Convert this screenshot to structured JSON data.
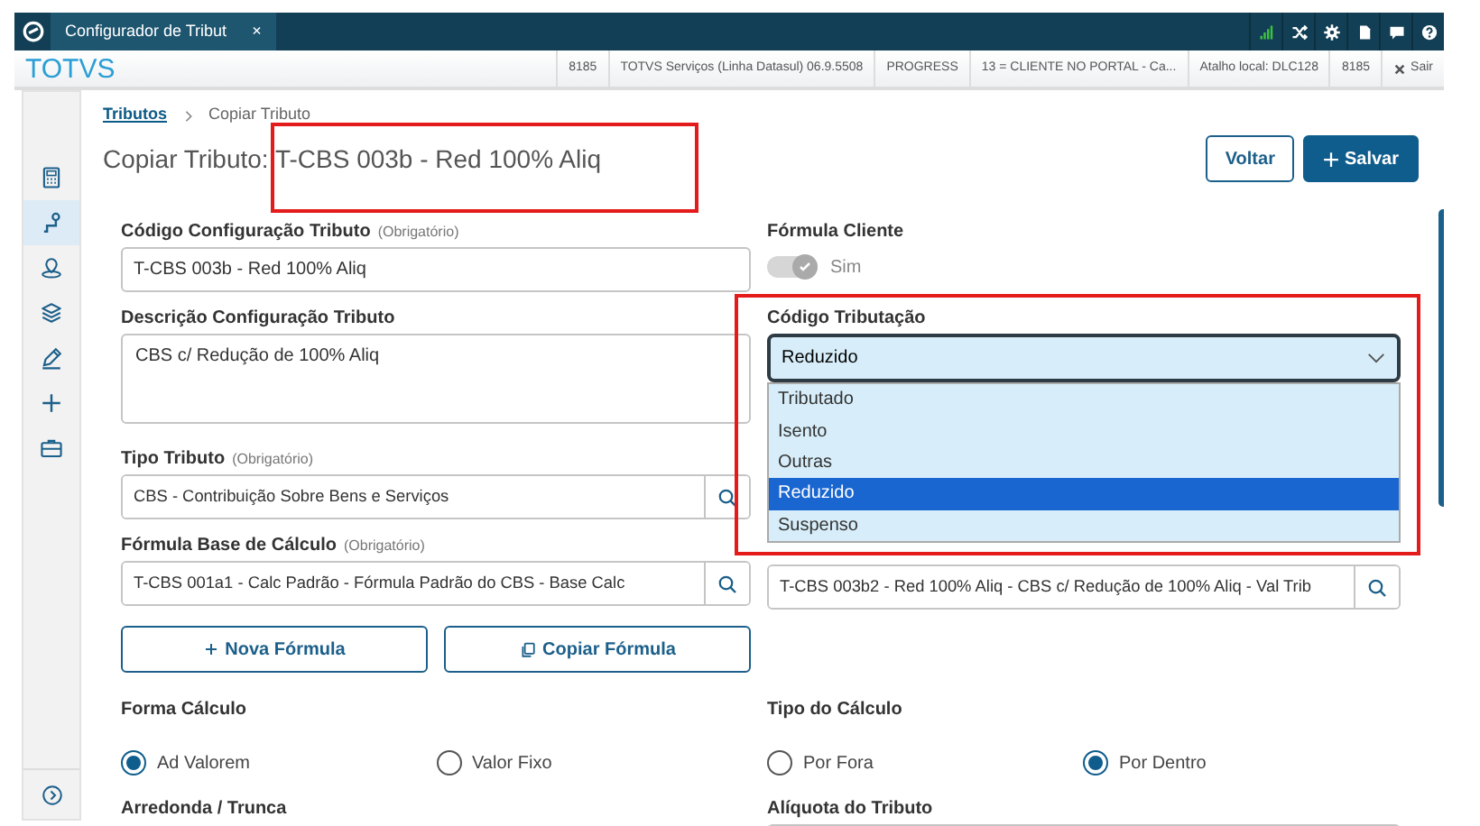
{
  "top_bar": {
    "tabs": [
      {
        "label": "Configurador de Tribut",
        "close": "×",
        "selected": true
      }
    ]
  },
  "header": {
    "brand": "TOTVS",
    "info": [
      "8185",
      "TOTVS Serviços (Linha Datasul) 06.9.5508",
      "PROGRESS",
      "13 = CLIENTE NO PORTAL - Ca...",
      "Atalho local: DLC128",
      "8185"
    ],
    "logout": "Sair"
  },
  "sidebar": {
    "items": [
      {
        "selected": false
      },
      {
        "selected": true
      },
      {
        "selected": false
      },
      {
        "selected": false
      },
      {
        "selected": false
      },
      {
        "selected": false
      },
      {
        "selected": false
      }
    ]
  },
  "breadcrumb": [
    {
      "label": "Tributos",
      "link": true
    },
    {
      "label": "Copiar Tributo",
      "link": false
    }
  ],
  "title": "Copiar Tributo: T-CBS 003b - Red 100% Aliq",
  "actions": [
    {
      "label": "Voltar",
      "kind": "outline"
    },
    {
      "label": "Salvar",
      "kind": "primary"
    }
  ],
  "rows": [
    [
      {
        "kind": "text",
        "label": "Código Configuração Tributo",
        "note": "(Obrigatório)",
        "value": "T-CBS 003b - Red 100% Aliq"
      },
      {
        "kind": "toggle",
        "label": "Fórmula Cliente",
        "on": true,
        "disabled": true,
        "text": "Sim"
      }
    ],
    [
      {
        "kind": "textarea",
        "label": "Descrição Configuração Tributo",
        "value": "CBS c/ Redução de 100% Aliq"
      },
      {
        "kind": "select",
        "label": "Código Tributação",
        "value": "Reduzido",
        "expanded": true,
        "options": [
          {
            "label": "Tributado",
            "selected": false
          },
          {
            "label": "Isento",
            "selected": false
          },
          {
            "label": "Outras",
            "selected": false
          },
          {
            "label": "Reduzido",
            "selected": true
          },
          {
            "label": "Suspenso",
            "selected": false
          }
        ]
      }
    ],
    [
      {
        "kind": "lookup",
        "label": "Tipo Tributo",
        "note": "(Obrigatório)",
        "value": "CBS - Contribuição Sobre Bens e Serviços"
      }
    ],
    [
      {
        "kind": "lookup",
        "label": "Fórmula Base de Cálculo",
        "note": "(Obrigatório)",
        "value": "T-CBS 001a1 - Calc Padrão - Fórmula Padrão do CBS - Base Calc"
      },
      {
        "kind": "lookup",
        "value": "T-CBS 003b2 - Red 100% Aliq - CBS c/ Redução de 100% Aliq - Val Trib"
      }
    ],
    [
      {
        "kind": "buttons",
        "items": [
          {
            "label": "Nova Fórmula"
          },
          {
            "label": "Copiar Fórmula"
          }
        ]
      }
    ],
    [
      {
        "kind": "radio",
        "label": "Forma Cálculo",
        "options": [
          {
            "label": "Ad Valorem",
            "selected": true
          },
          {
            "label": "Valor Fixo",
            "selected": false
          }
        ]
      },
      {
        "kind": "radio",
        "label": "Tipo do Cálculo",
        "options": [
          {
            "label": "Por Fora",
            "selected": false
          },
          {
            "label": "Por Dentro",
            "selected": true
          }
        ]
      }
    ],
    [
      {
        "kind": "heading",
        "label": "Arredonda / Trunca"
      },
      {
        "kind": "text",
        "label": "Alíquota do Tributo"
      }
    ]
  ]
}
